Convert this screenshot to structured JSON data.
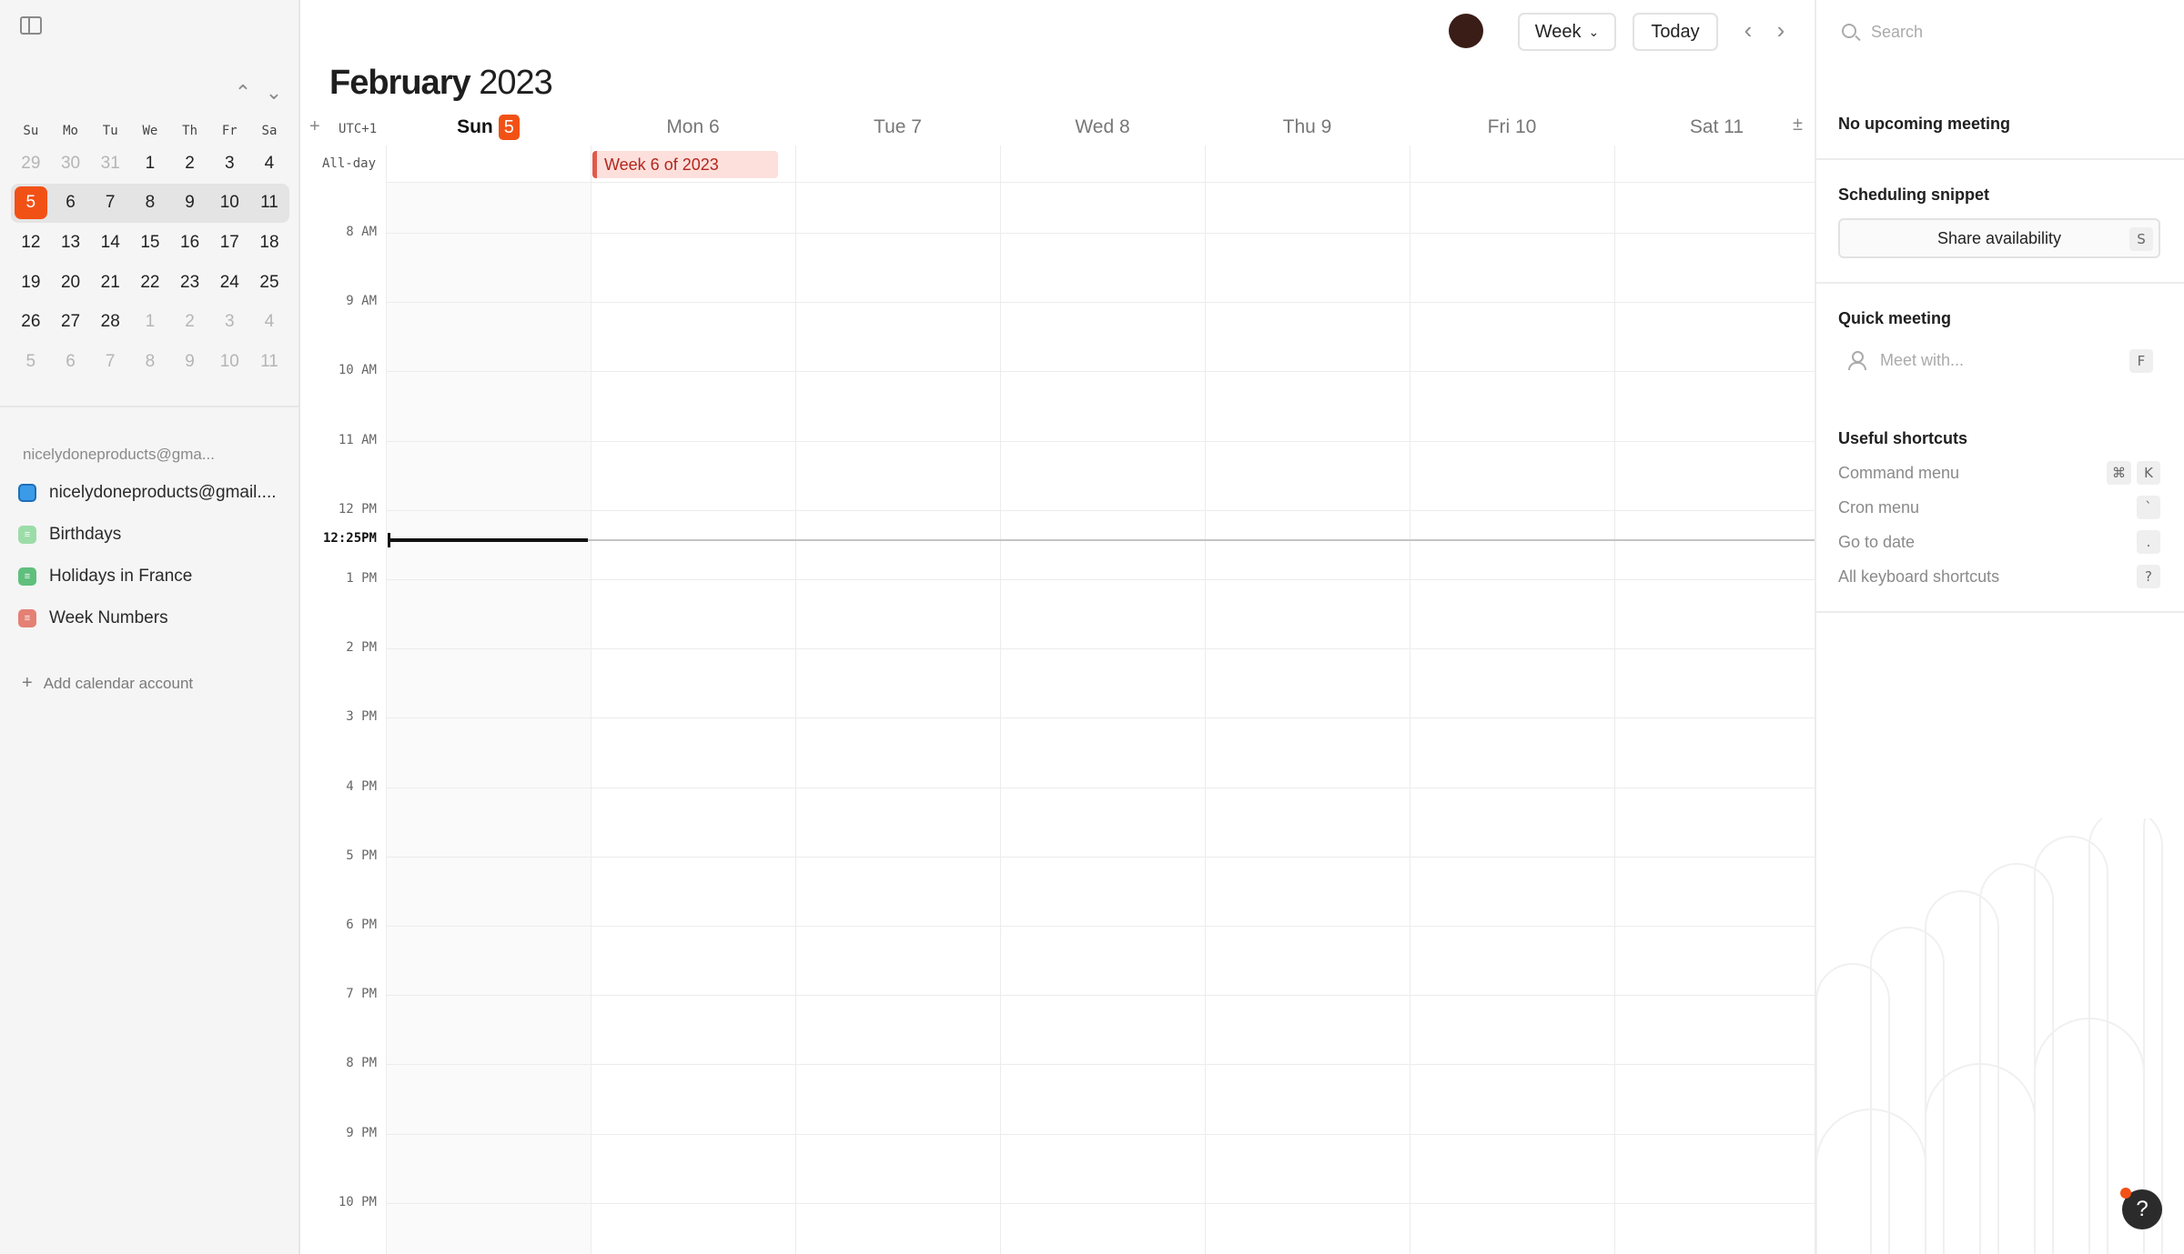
{
  "mini_calendar": {
    "weekdays": [
      "Su",
      "Mo",
      "Tu",
      "We",
      "Th",
      "Fr",
      "Sa"
    ],
    "weeks": [
      [
        {
          "d": "29",
          "dim": true
        },
        {
          "d": "30",
          "dim": true
        },
        {
          "d": "31",
          "dim": true
        },
        {
          "d": "1"
        },
        {
          "d": "2"
        },
        {
          "d": "3"
        },
        {
          "d": "4"
        }
      ],
      [
        {
          "d": "5",
          "today": true
        },
        {
          "d": "6"
        },
        {
          "d": "7"
        },
        {
          "d": "8"
        },
        {
          "d": "9"
        },
        {
          "d": "10"
        },
        {
          "d": "11"
        }
      ],
      [
        {
          "d": "12"
        },
        {
          "d": "13"
        },
        {
          "d": "14"
        },
        {
          "d": "15"
        },
        {
          "d": "16"
        },
        {
          "d": "17"
        },
        {
          "d": "18"
        }
      ],
      [
        {
          "d": "19"
        },
        {
          "d": "20"
        },
        {
          "d": "21"
        },
        {
          "d": "22"
        },
        {
          "d": "23"
        },
        {
          "d": "24"
        },
        {
          "d": "25"
        }
      ],
      [
        {
          "d": "26"
        },
        {
          "d": "27"
        },
        {
          "d": "28"
        },
        {
          "d": "1",
          "dim": true
        },
        {
          "d": "2",
          "dim": true
        },
        {
          "d": "3",
          "dim": true
        },
        {
          "d": "4",
          "dim": true
        }
      ],
      [
        {
          "d": "5",
          "dim": true
        },
        {
          "d": "6",
          "dim": true
        },
        {
          "d": "7",
          "dim": true
        },
        {
          "d": "8",
          "dim": true
        },
        {
          "d": "9",
          "dim": true
        },
        {
          "d": "10",
          "dim": true
        },
        {
          "d": "11",
          "dim": true
        }
      ]
    ],
    "current_week_index": 1
  },
  "sidebar": {
    "account_label": "nicelydoneproducts@gma...",
    "calendars": [
      {
        "label": "nicelydoneproducts@gmail....",
        "color": "#3b9be8",
        "icon": "checkbox-icon"
      },
      {
        "label": "Birthdays",
        "color": "#7fd48f",
        "icon": "rss-icon"
      },
      {
        "label": "Holidays in France",
        "color": "#2fae55",
        "icon": "rss-icon"
      },
      {
        "label": "Week Numbers",
        "color": "#e05a4a",
        "icon": "rss-icon"
      }
    ],
    "add_account": "Add calendar account"
  },
  "toolbar": {
    "view": "Week",
    "today": "Today"
  },
  "header": {
    "month": "February",
    "year": "2023",
    "timezone": "UTC+1"
  },
  "days": [
    {
      "label": "Sun",
      "badge": "5",
      "active": true
    },
    {
      "label": "Mon 6"
    },
    {
      "label": "Tue 7"
    },
    {
      "label": "Wed 8"
    },
    {
      "label": "Thu 9"
    },
    {
      "label": "Fri 10"
    },
    {
      "label": "Sat 11"
    }
  ],
  "grid": {
    "allday_label": "All-day",
    "allday_event": "Week 6 of 2023",
    "hours": [
      "8 AM",
      "9 AM",
      "10 AM",
      "11 AM",
      "12 PM",
      "1 PM",
      "2 PM",
      "3 PM",
      "4 PM",
      "5 PM",
      "6 PM",
      "7 PM",
      "8 PM",
      "9 PM",
      "10 PM"
    ],
    "now_label": "12:25PM"
  },
  "right_panel": {
    "search_placeholder": "Search",
    "no_meeting": "No upcoming meeting",
    "scheduling_title": "Scheduling snippet",
    "share_label": "Share availability",
    "share_key": "S",
    "quick_title": "Quick meeting",
    "meet_placeholder": "Meet with...",
    "meet_key": "F",
    "shortcuts_title": "Useful shortcuts",
    "shortcuts": [
      {
        "label": "Command menu",
        "keys": [
          "⌘",
          "K"
        ]
      },
      {
        "label": "Cron menu",
        "keys": [
          "`"
        ]
      },
      {
        "label": "Go to date",
        "keys": [
          "."
        ]
      },
      {
        "label": "All keyboard shortcuts",
        "keys": [
          "?"
        ]
      }
    ],
    "help": "?"
  },
  "colors": {
    "accent": "#f25116",
    "event_bg": "#fde0dc",
    "event_text": "#b3261e"
  }
}
